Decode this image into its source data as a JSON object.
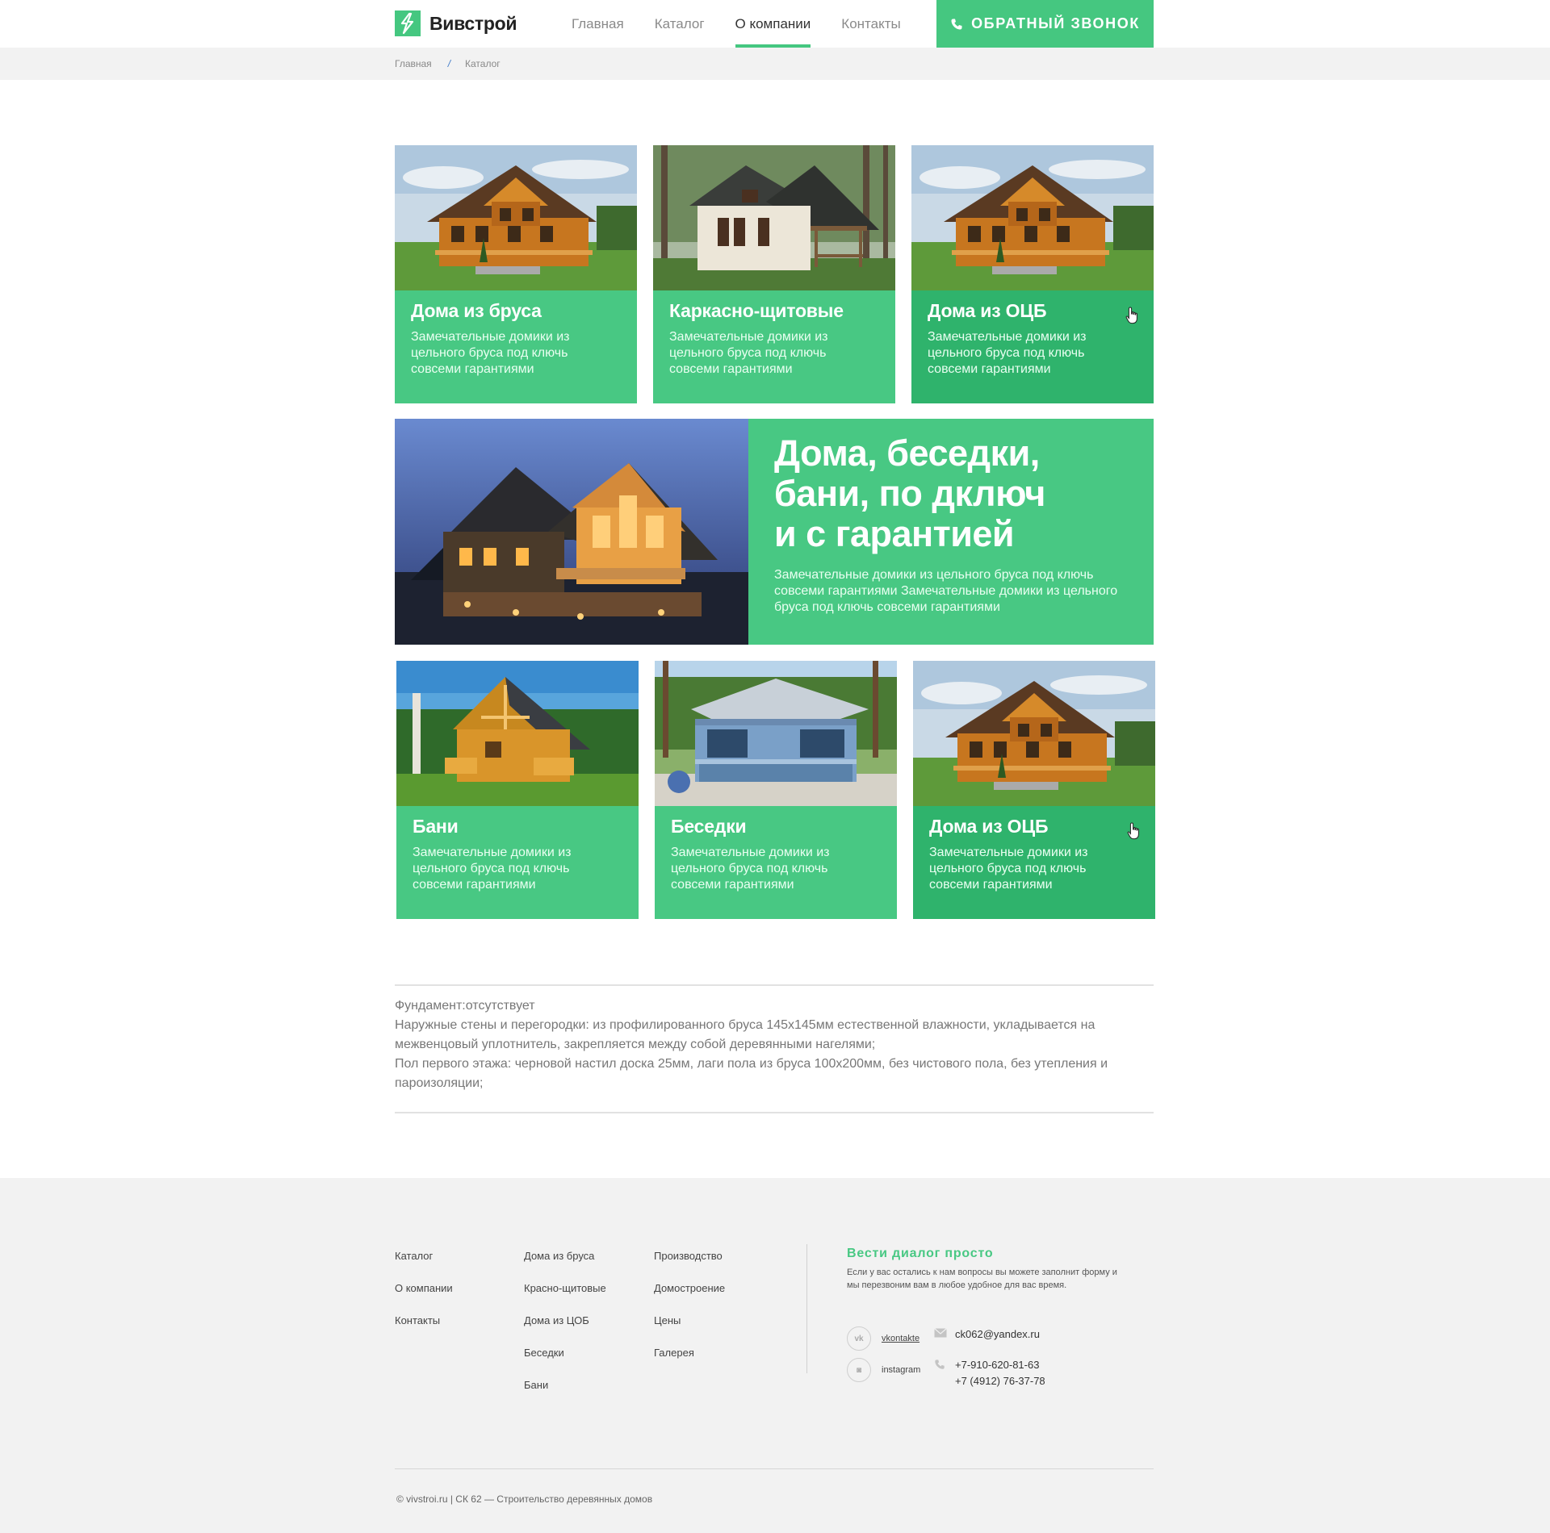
{
  "header": {
    "logo_text": "Вивстрой",
    "nav": [
      "Главная",
      "Каталог",
      "О компании",
      "Контакты"
    ],
    "active_nav": "О компании",
    "callback_label": "ОБРАТНЫЙ ЗВОНОК"
  },
  "breadcrumb": {
    "items": [
      "Главная",
      "Каталог"
    ],
    "separator": "/"
  },
  "cards_top": [
    {
      "title": "Дома из бруса",
      "desc": "Замечательные домики из цельного бруса под ключь совсеми гарантиями"
    },
    {
      "title": "Каркасно-щитовые",
      "desc": "Замечательные домики из цельного бруса под ключь совсеми гарантиями"
    },
    {
      "title": "Дома из ОЦБ",
      "desc": "Замечательные домики из цельного бруса под ключь совсеми гарантиями"
    }
  ],
  "promo": {
    "title_lines": [
      "Дома, беседки,",
      "бани, по дключ",
      "и с гарантией"
    ],
    "desc": "Замечательные домики из цельного бруса под ключь совсеми гарантиями Замечательные домики из цельного бруса под ключь совсеми гарантиями"
  },
  "cards_bottom": [
    {
      "title": "Бани",
      "desc": "Замечательные домики из цельного бруса под ключь совсеми гарантиями"
    },
    {
      "title": "Беседки",
      "desc": "Замечательные домики из цельного бруса под ключь совсеми гарантиями"
    },
    {
      "title": "Дома из ОЦБ",
      "desc": "Замечательные домики из цельного бруса под ключь совсеми гарантиями"
    }
  ],
  "description": {
    "lines": [
      "Фундамент:отсутствует",
      "Наружные стены и перегородки: из профилированного бруса 145х145мм естественной влажности, укладывается на",
      "межвенцовый уплотнитель, закрепляется между собой деревянными нагелями;",
      "Пол первого этажа: черновой настил доска 25мм, лаги пола из бруса 100х200мм, без чистового пола, без утепления и",
      "пароизоляции;"
    ]
  },
  "footer": {
    "col1": [
      "Каталог",
      "О компании",
      "Контакты"
    ],
    "col2": [
      "Дома из бруса",
      "Красно-щитовые",
      "Дома из ЦОБ",
      "Беседки",
      "Бани"
    ],
    "col3": [
      "Производство",
      "Домостроение",
      "Цены",
      "Галерея"
    ],
    "dialog_title": "Вести диалог просто",
    "dialog_text": "Если у вас остались к нам вопросы вы можете заполнит форму и мы перезвоним вам в любое удобное для вас время.",
    "social": [
      {
        "label": "vkontakte",
        "icon": "vk-icon",
        "glyph": "vk"
      },
      {
        "label": "instagram",
        "icon": "instagram-icon",
        "glyph": "◙"
      }
    ],
    "email": "ck062@yandex.ru",
    "phones": [
      "+7-910-620-81-63",
      "+7 (4912) 76-37-78"
    ],
    "copyright": "© vivstroi.ru | СК 62 — Строительство деревянных домов"
  },
  "colors": {
    "accent": "#48c883",
    "accent_dark": "#2fb36c",
    "footer_bg": "#f2f2f2"
  }
}
